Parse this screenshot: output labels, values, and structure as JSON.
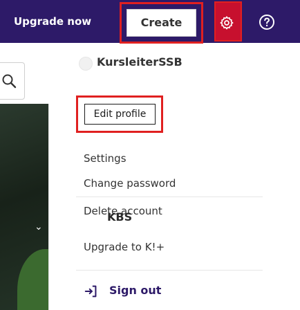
{
  "topbar": {
    "upgrade_label": "Upgrade now",
    "create_label": "Create"
  },
  "profile": {
    "username": "KursleiterSSB",
    "edit_label": "Edit profile"
  },
  "menu": {
    "settings": "Settings",
    "change_password": "Change password",
    "delete_account": "Delete account",
    "kbs": "KBS",
    "upgrade": "Upgrade to K!+",
    "sign_out": "Sign out"
  },
  "icons": {
    "settings": "gear-icon",
    "help": "help-icon",
    "search": "search-icon",
    "sign_out": "sign-out-icon"
  },
  "colors": {
    "topbar_bg": "#2d1a68",
    "highlight": "#e02020",
    "settings_active": "#c7102e"
  }
}
